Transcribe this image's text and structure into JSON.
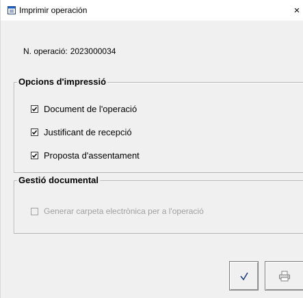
{
  "window": {
    "title": "Imprimir operación",
    "close_glyph": "×",
    "icon": "print-dialog-icon"
  },
  "operation": {
    "label": "N. operació:",
    "number": "2023000034"
  },
  "print_options": {
    "legend": "Opcions d'impressió",
    "items": [
      {
        "label": "Document de l'operació",
        "checked": true
      },
      {
        "label": "Justificant de recepció",
        "checked": true
      },
      {
        "label": "Proposta d'assentament",
        "checked": true
      }
    ]
  },
  "document_management": {
    "legend": "Gestió documental",
    "items": [
      {
        "label": "Generar carpeta electrònica per a l'operació",
        "checked": false,
        "enabled": false
      }
    ]
  },
  "buttons": {
    "ok_icon": "checkmark-icon",
    "print_icon": "printer-icon"
  },
  "colors": {
    "background": "#f0f0f0",
    "titlebar": "#ffffff",
    "disabled_text": "#a0a0a0"
  }
}
